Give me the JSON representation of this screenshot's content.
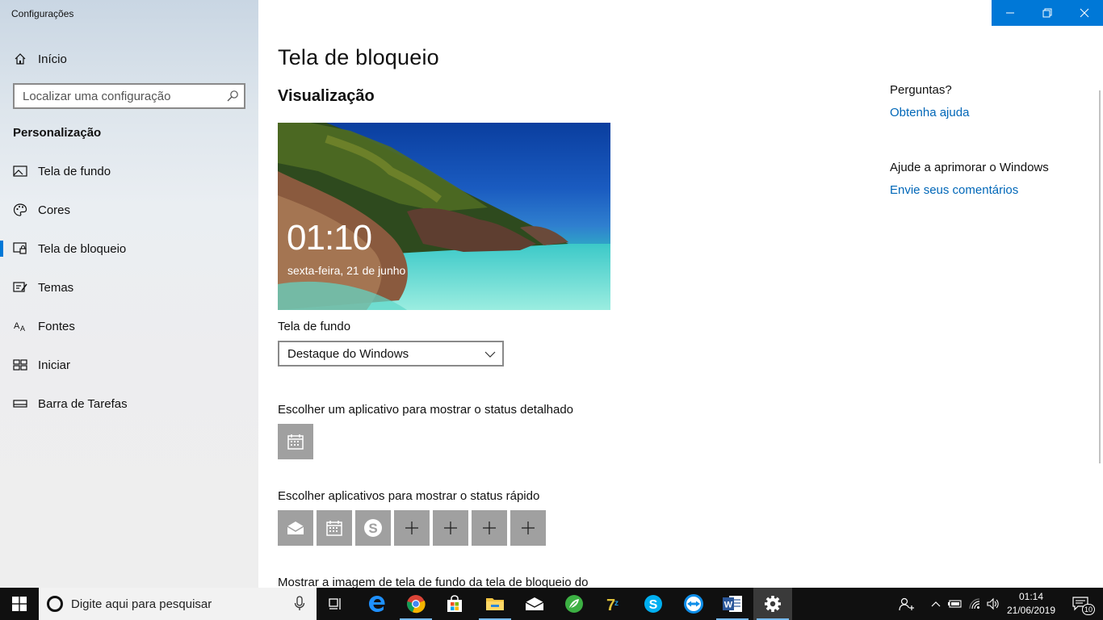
{
  "app": {
    "title": "Configurações"
  },
  "sidebar": {
    "home_label": "Início",
    "search_placeholder": "Localizar uma configuração",
    "section_heading": "Personalização",
    "items": [
      {
        "label": "Tela de fundo",
        "icon": "picture-icon"
      },
      {
        "label": "Cores",
        "icon": "palette-icon"
      },
      {
        "label": "Tela de bloqueio",
        "icon": "lock-screen-icon",
        "active": true
      },
      {
        "label": "Temas",
        "icon": "brush-icon"
      },
      {
        "label": "Fontes",
        "icon": "font-icon"
      },
      {
        "label": "Iniciar",
        "icon": "start-grid-icon"
      },
      {
        "label": "Barra de Tarefas",
        "icon": "taskbar-icon"
      }
    ]
  },
  "main": {
    "page_title": "Tela de bloqueio",
    "preview_heading": "Visualização",
    "preview": {
      "time": "01:10",
      "date": "sexta-feira, 21 de junho"
    },
    "background_label": "Tela de fundo",
    "background_value": "Destaque do Windows",
    "detailed_status_label": "Escolher um aplicativo para mostrar o status detalhado",
    "quick_status_label": "Escolher aplicativos para mostrar o status rápido",
    "cut_label": "Mostrar a imagem de tela de fundo da tela de bloqueio do"
  },
  "right_panel": {
    "questions_heading": "Perguntas?",
    "help_link": "Obtenha ajuda",
    "improve_heading": "Ajude a aprimorar o Windows",
    "feedback_link": "Envie seus comentários"
  },
  "taskbar": {
    "search_placeholder": "Digite aqui para pesquisar",
    "clock_time": "01:14",
    "clock_date": "21/06/2019",
    "notification_count": "10"
  },
  "colors": {
    "accent": "#0078d7",
    "link": "#0067b8",
    "tile": "#a0a0a0",
    "taskbar": "#101010"
  }
}
